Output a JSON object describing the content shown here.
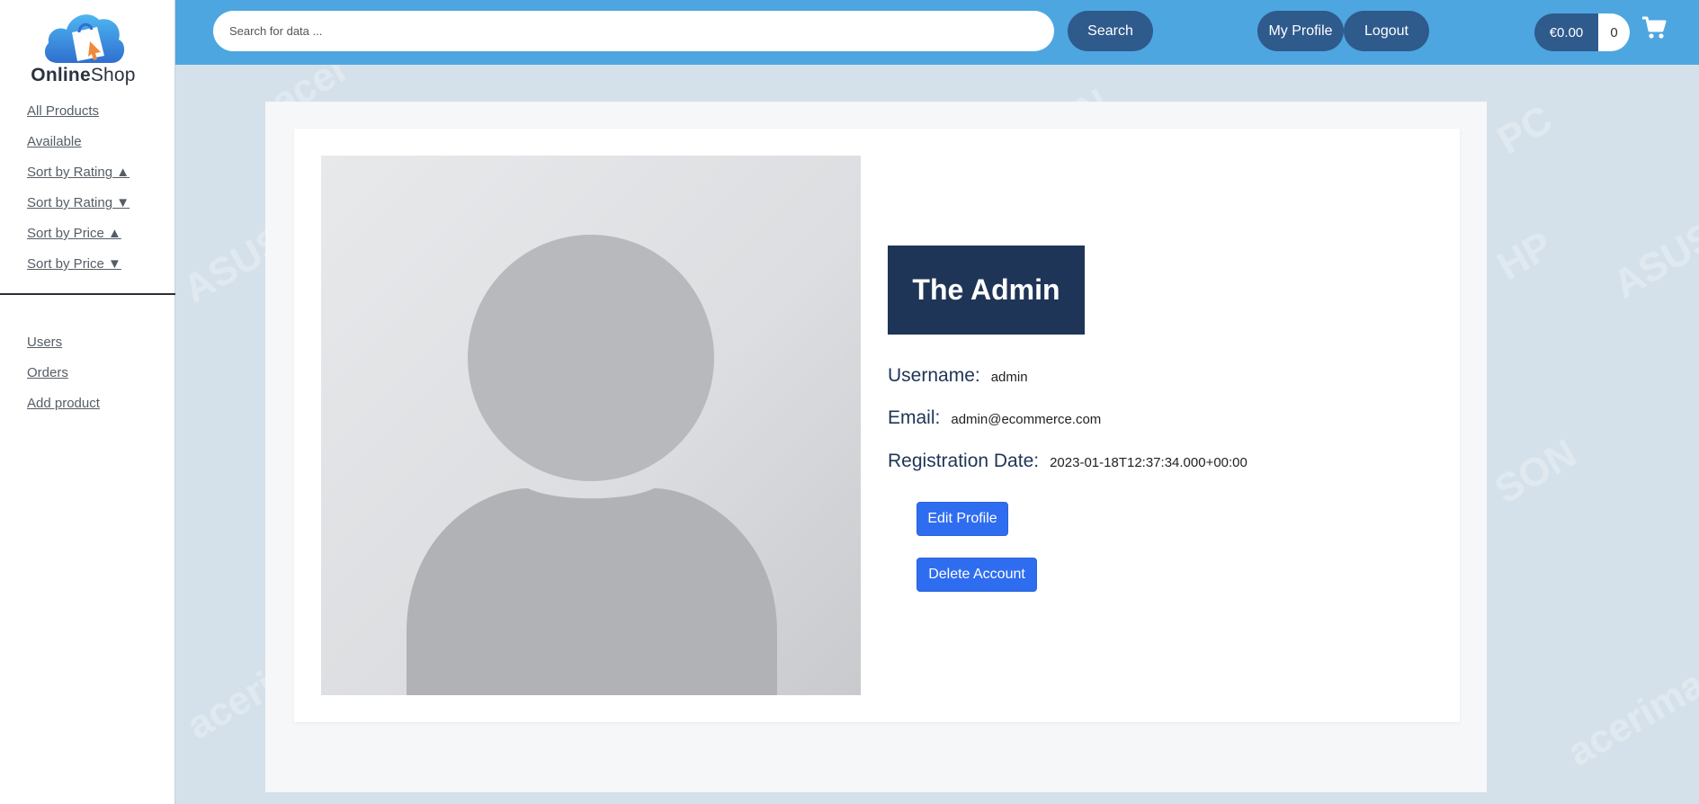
{
  "logo": {
    "text_bold": "Online",
    "text_regular": "Shop"
  },
  "sidebar": {
    "filters": [
      {
        "label": "All Products"
      },
      {
        "label": "Available"
      },
      {
        "label": "Sort by Rating ▲"
      },
      {
        "label": "Sort by Rating ▼"
      },
      {
        "label": "Sort by Price ▲"
      },
      {
        "label": "Sort by Price ▼"
      }
    ],
    "admin_links": [
      {
        "label": "Users"
      },
      {
        "label": "Orders"
      },
      {
        "label": "Add product"
      }
    ]
  },
  "header": {
    "search_placeholder": "Search for data ...",
    "search_label": "Search",
    "my_profile_label": "My Profile",
    "logout_label": "Logout",
    "cart_total": "€0.00",
    "cart_count": "0"
  },
  "watermarks": [
    "acer",
    "SON",
    "PC",
    "ASUS",
    "HP",
    "ASUS",
    "SON",
    "acerimar",
    "acerimar"
  ],
  "profile": {
    "name": "The Admin",
    "username_label": "Username:",
    "username": "admin",
    "email_label": "Email:",
    "email": "admin@ecommerce.com",
    "registration_label": "Registration Date:",
    "registration_date": "2023-01-18T12:37:34.000+00:00",
    "edit_label": "Edit Profile",
    "delete_label": "Delete Account"
  },
  "colors": {
    "header_bg": "#4da6e0",
    "pill_bg": "#2f5a8c",
    "name_badge_bg": "#1f3557",
    "button_blue": "#2f6df0",
    "page_bg": "#d5e1ea"
  }
}
